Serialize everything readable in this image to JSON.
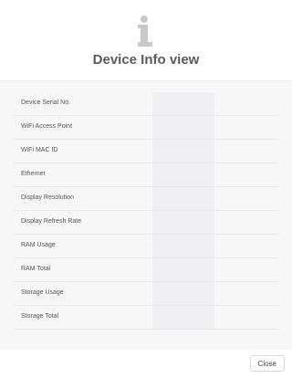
{
  "dialog": {
    "icon": "info-icon",
    "title": "Device Info view",
    "close_label": "Close"
  },
  "rows": [
    {
      "label": "Device Serial No.",
      "value": ""
    },
    {
      "label": "WiFi Access Point",
      "value": ""
    },
    {
      "label": "WiFi MAC ID",
      "value": ""
    },
    {
      "label": "Ethernet",
      "value": ""
    },
    {
      "label": "Display Resolution",
      "value": ""
    },
    {
      "label": "Display Refresh Rate",
      "value": ""
    },
    {
      "label": "RAM Usage",
      "value": ""
    },
    {
      "label": "RAM Total",
      "value": ""
    },
    {
      "label": "Storage Usage",
      "value": ""
    },
    {
      "label": "Storage Total",
      "value": ""
    }
  ]
}
